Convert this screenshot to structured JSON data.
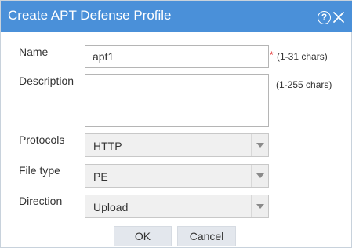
{
  "dialog": {
    "title": "Create APT Defense Profile",
    "help_glyph": "?",
    "close_icon": "close-icon",
    "help_icon": "help-circle-icon",
    "colors": {
      "titlebar": "#4a90d9",
      "required": "#e02020"
    }
  },
  "form": {
    "name": {
      "label": "Name",
      "value": "apt1",
      "required_mark": "*",
      "hint": "(1-31 chars)"
    },
    "description": {
      "label": "Description",
      "value": "",
      "hint": "(1-255 chars)"
    },
    "protocols": {
      "label": "Protocols",
      "value": "HTTP"
    },
    "file_type": {
      "label": "File type",
      "value": "PE"
    },
    "direction": {
      "label": "Direction",
      "value": "Upload"
    }
  },
  "buttons": {
    "ok": "OK",
    "cancel": "Cancel"
  }
}
